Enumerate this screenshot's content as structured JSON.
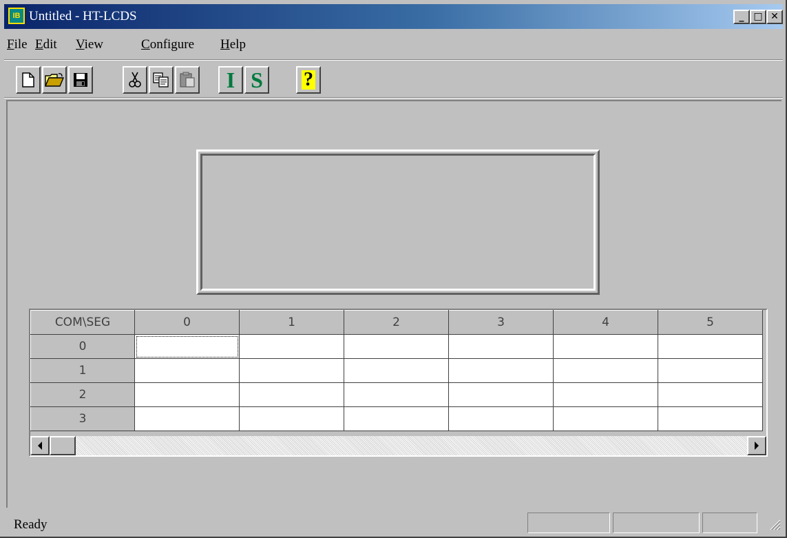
{
  "window": {
    "title": "Untitled - HT-LCDS",
    "icon": "app-logo-icon",
    "icon_text": "IB",
    "minimize_glyph": "_",
    "maximize_glyph": "□",
    "close_glyph": "✕"
  },
  "menu": {
    "file": {
      "key": "F",
      "rest": "ile"
    },
    "edit": {
      "key": "E",
      "rest": "dit"
    },
    "view": {
      "key": "V",
      "rest": "iew"
    },
    "configure": {
      "key": "C",
      "rest": "onfigure"
    },
    "help": {
      "key": "H",
      "rest": "elp"
    }
  },
  "toolbar": {
    "buttons": [
      "new-file-icon",
      "open-folder-icon",
      "save-disk-icon",
      "cut-scissors-icon",
      "copy-icon",
      "paste-icon",
      "I",
      "S",
      "?"
    ],
    "i_label": "I",
    "s_label": "S",
    "help_label": "?"
  },
  "grid": {
    "corner": "COM\\SEG",
    "seg_headers": [
      "0",
      "1",
      "2",
      "3",
      "4",
      "5"
    ],
    "com_rows": [
      "0",
      "1",
      "2",
      "3"
    ],
    "selected_cell": {
      "com": "0",
      "seg": "0"
    }
  },
  "status": {
    "text": "Ready"
  },
  "colors": {
    "titlebar_start": "#0a246a",
    "titlebar_end": "#a6caf0",
    "face": "#c0c0c0",
    "toolbar_letters": "#007a3d"
  }
}
